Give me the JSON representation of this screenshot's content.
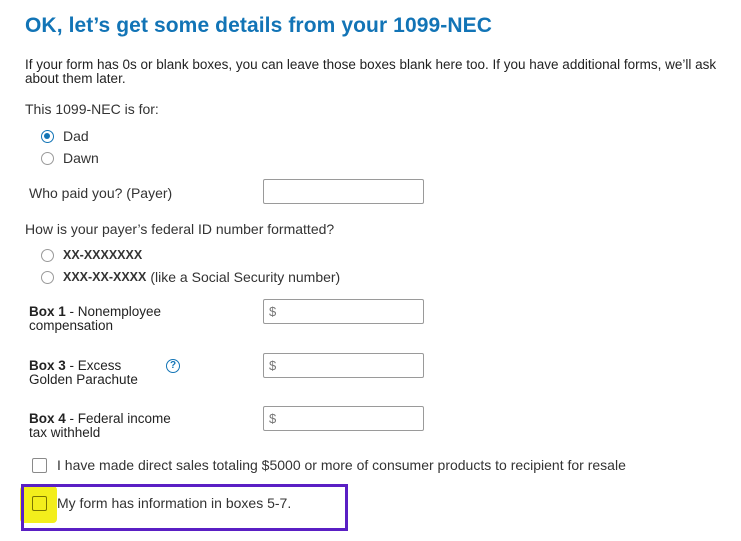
{
  "title": "OK, let’s get some details from your 1099-NEC",
  "intro": "If your form has 0s or blank boxes, you can leave those boxes blank here too. If you have additional forms, we’ll ask about them later.",
  "for_question": "This 1099-NEC is for:",
  "for_options": [
    {
      "label": "Dad",
      "checked": true
    },
    {
      "label": "Dawn",
      "checked": false
    }
  ],
  "payer": {
    "label": "Who paid you? (Payer)",
    "value": ""
  },
  "id_question": "How is your payer’s federal ID number formatted?",
  "id_options": [
    {
      "mask": "XX-XXXXXXX",
      "note": ""
    },
    {
      "mask": "XXX-XX-XXXX",
      "note": "(like a Social Security number)"
    }
  ],
  "boxes": [
    {
      "bold": "Box 1",
      "rest": " - Nonemployee",
      "line2": "compensation",
      "placeholder": "$"
    },
    {
      "bold": "Box 3",
      "rest": " - Excess",
      "line2": "Golden Parachute",
      "placeholder": "$"
    },
    {
      "bold": "Box 4",
      "rest": " - Federal income",
      "line2": "tax withheld",
      "placeholder": "$"
    }
  ],
  "help_glyph": "?",
  "direct_sales": "I have made direct sales totaling $5000 or more of consumer products to recipient for resale",
  "boxes57": "My form has information in boxes 5-7.",
  "colors": {
    "accent": "#1274b6",
    "highlight": "#f3ee1c",
    "outline": "#5a1fc4"
  }
}
